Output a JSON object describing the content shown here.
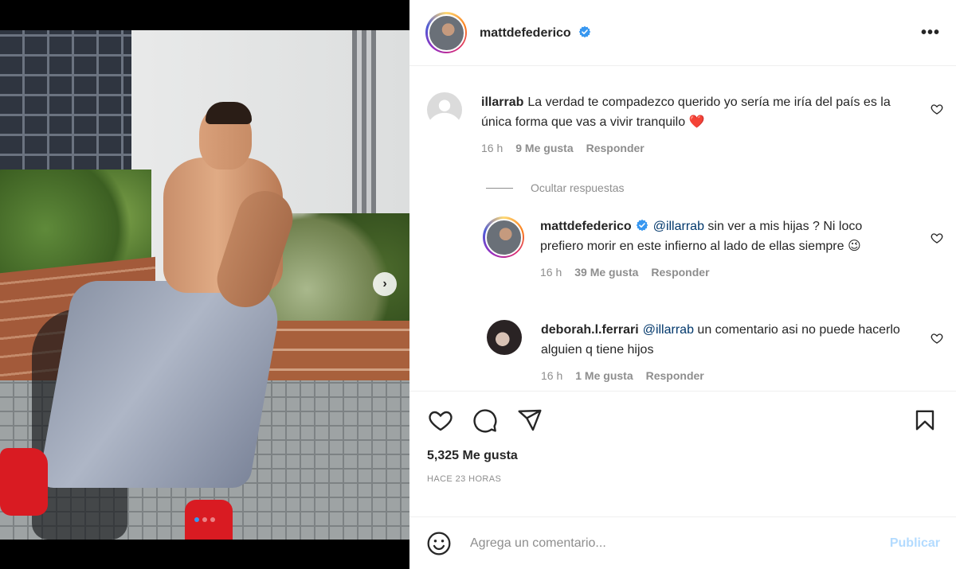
{
  "post": {
    "author": "mattdefederico",
    "likes_text": "5,325 Me gusta",
    "time_ago": "HACE 23 HORAS",
    "carousel_total": 3,
    "carousel_active": 1
  },
  "comments": [
    {
      "user": "illarrab",
      "text": "La verdad te compadezco querido yo sería me iría del país es la única forma que vas a vivir tranquilo",
      "emoji": "❤️",
      "time": "16 h",
      "likes": "9 Me gusta",
      "reply_label": "Responder"
    }
  ],
  "hide_replies_label": "Ocultar respuestas",
  "replies": [
    {
      "user": "mattdefederico",
      "mention": "@illarrab",
      "text": "sin ver a mis hijas ? Ni loco prefiero morir en este infierno al lado de ellas siempre",
      "emoji": "😉",
      "time": "16 h",
      "likes": "39 Me gusta",
      "reply_label": "Responder"
    },
    {
      "user": "deborah.l.ferrari",
      "mention": "@illarrab",
      "text": "un comentario asi no puede hacerlo alguien q tiene hijos",
      "time": "16 h",
      "likes": "1 Me gusta",
      "reply_label": "Responder"
    }
  ],
  "add_comment": {
    "placeholder": "Agrega un comentario...",
    "publish_label": "Publicar"
  },
  "colors": {
    "accent_blue": "#0095f6",
    "publish_disabled": "#b3dbff",
    "verified": "#3897f0",
    "heart_red": "#ed4956"
  },
  "icons": [
    "verified-badge-icon",
    "more-options-icon",
    "heart-icon",
    "comment-icon",
    "share-icon",
    "bookmark-icon",
    "emoji-icon",
    "chevron-right-icon"
  ]
}
